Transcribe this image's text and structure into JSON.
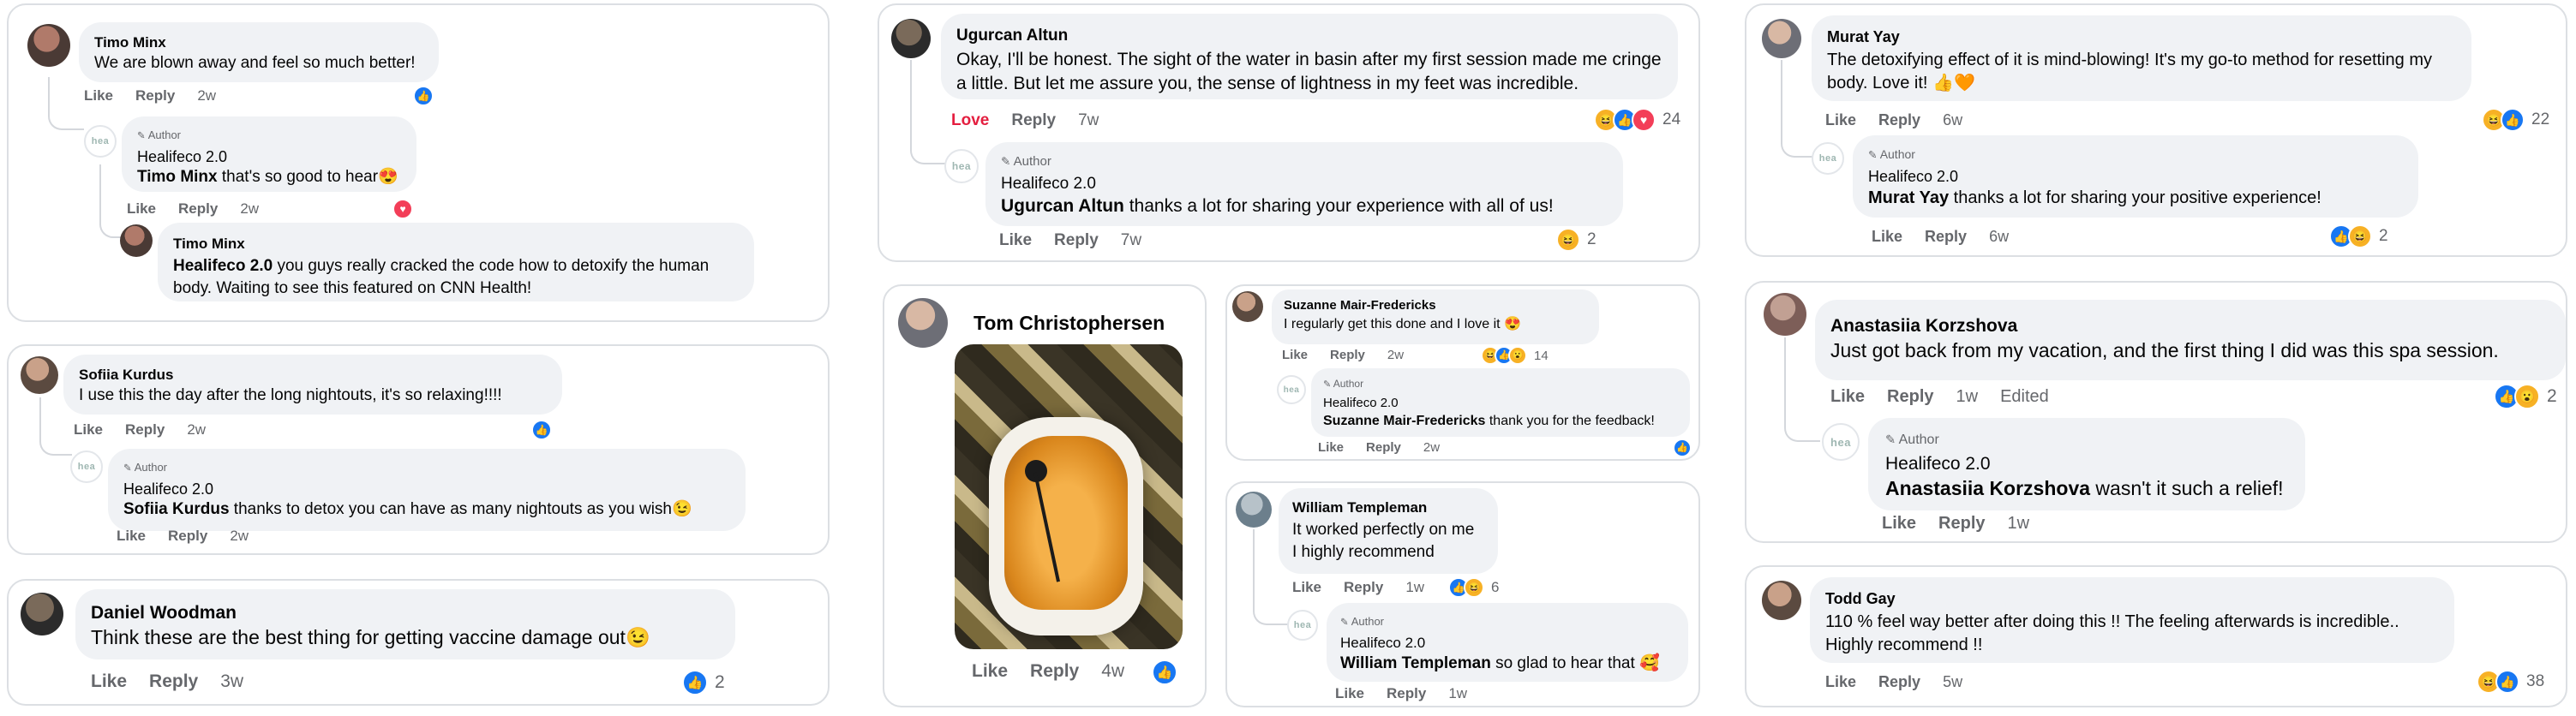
{
  "labels": {
    "like": "Like",
    "reply": "Reply",
    "love": "Love",
    "author": "Author",
    "edited": "Edited"
  },
  "colors": {
    "accent": "#1877f2",
    "love": "#e41e3f",
    "bubble": "#f0f2f5",
    "muted": "#65676b"
  },
  "c1": {
    "name": "Timo Minx",
    "text": "We are blown away and feel so much better!",
    "time": "2w",
    "react_icon": "like-icon",
    "reply1": {
      "avatar": "hea",
      "name": "Healifeco 2.0",
      "mention": "Timo Minx",
      "text": " that's so good to hear😍",
      "time": "2w",
      "react_icon": "heart-icon"
    },
    "reply2": {
      "name": "Timo Minx",
      "mention": "Healifeco 2.0",
      "text": " you guys really cracked the code how to detoxify the human body. Waiting to see this featured on CNN Health!"
    }
  },
  "c2": {
    "name": "Sofiia Kurdus",
    "text": "I use this the day after the long nightouts, it's so relaxing!!!!",
    "time": "2w",
    "react_icon": "like-icon",
    "reply": {
      "avatar": "hea",
      "name": "Healifeco 2.0",
      "mention": "Sofiia Kurdus",
      "text": " thanks to detox you can have as many nightouts as you wish😉",
      "time": "2w"
    }
  },
  "c3": {
    "name": "Daniel Woodman",
    "text": "Think these are the best thing for getting vaccine damage out😉",
    "time": "3w",
    "count": "2"
  },
  "c4": {
    "name": "Ugurcan Altun",
    "text": "Okay, I'll be honest. The sight of the water in basin after my first session made me cringe a little. But let me assure you, the sense of lightness in my feet was incredible.",
    "time": "7w",
    "count": "24",
    "reply": {
      "avatar": "hea",
      "name": "Healifeco 2.0",
      "mention": "Ugurcan Altun",
      "text": " thanks a lot for sharing your experience with all of us!",
      "time": "7w",
      "count": "2"
    }
  },
  "c5": {
    "name": "Tom Christophersen",
    "time": "4w"
  },
  "c6": {
    "name": "Suzanne Mair-Fredericks",
    "text": "I regularly get this done and I love it 😍",
    "time": "2w",
    "count": "14",
    "reply": {
      "avatar": "hea",
      "name": "Healifeco 2.0",
      "mention": "Suzanne Mair-Fredericks",
      "text": " thank you for the feedback!",
      "time": "2w"
    }
  },
  "c7": {
    "name": "William Templeman",
    "text1": "It worked perfectly on me",
    "text2": "I highly recommend",
    "time": "1w",
    "count": "6",
    "reply": {
      "avatar": "hea",
      "name": "Healifeco 2.0",
      "mention": "William Templeman",
      "text": " so glad to hear that 🥰",
      "time": "1w"
    }
  },
  "c8": {
    "name": "Murat Yay",
    "text": "The detoxifying effect of it is mind-blowing! It's my go-to method for resetting my body. Love it! 👍🧡",
    "time": "6w",
    "count": "22",
    "reply": {
      "avatar": "hea",
      "name": "Healifeco 2.0",
      "mention": "Murat Yay",
      "text": " thanks a lot for sharing your positive experience!",
      "time": "6w",
      "count": "2"
    }
  },
  "c9": {
    "name": "Anastasiia Korzshova",
    "text": "Just got back from my vacation, and the first thing I did was this spa session.",
    "time": "1w",
    "count": "2",
    "reply": {
      "avatar": "hea",
      "name": "Healifeco 2.0",
      "mention": "Anastasiia Korzshova",
      "text": " wasn't it such a relief!",
      "time": "1w"
    }
  },
  "c10": {
    "name": "Todd Gay",
    "text": "110 % feel way better after doing this !! The feeling afterwards is incredible.. Highly recommend !!",
    "time": "5w",
    "count": "38"
  }
}
